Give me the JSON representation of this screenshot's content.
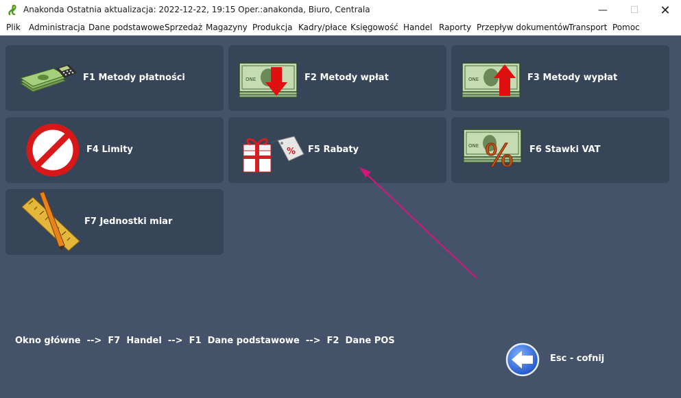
{
  "window": {
    "title": "Anakonda Ostatnia aktualizacja: 2022-12-22, 19:15 Oper.:anakonda, Biuro, Centrala",
    "minimize_glyph": "—",
    "maximize_glyph": "☐",
    "close_glyph": "✕"
  },
  "menu": [
    "Plik",
    "Administracja",
    "Dane podstawowe",
    "Sprzedaż",
    "Magazyny",
    "Produkcja",
    "Kadry/płace",
    "Księgowość",
    "Handel",
    "Raporty",
    "Przepływ dokumentów",
    "Transport",
    "Pomoc"
  ],
  "tiles": [
    {
      "label": "F1  Metody płatności",
      "icon": "money-calculator-icon"
    },
    {
      "label": "F2  Metody wpłat",
      "icon": "cash-down-arrow-icon"
    },
    {
      "label": "F3  Metody wypłat",
      "icon": "cash-up-arrow-icon"
    },
    {
      "label": "F4  Limity",
      "icon": "prohibited-icon"
    },
    {
      "label": "F5  Rabaty",
      "icon": "gift-tag-icon"
    },
    {
      "label": "F6  Stawki VAT",
      "icon": "cash-percent-icon"
    },
    {
      "label": "F7  Jednostki miar",
      "icon": "ruler-pencil-icon"
    }
  ],
  "breadcrumb": "Okno główne  -->  F7  Handel  -->  F1  Dane podstawowe  -->  F2  Dane POS",
  "back": {
    "label": "Esc - cofnij",
    "icon": "back-arrow-icon"
  },
  "colors": {
    "background": "#45536a",
    "tile": "#374558",
    "annotation_arrow": "#d6157a"
  }
}
